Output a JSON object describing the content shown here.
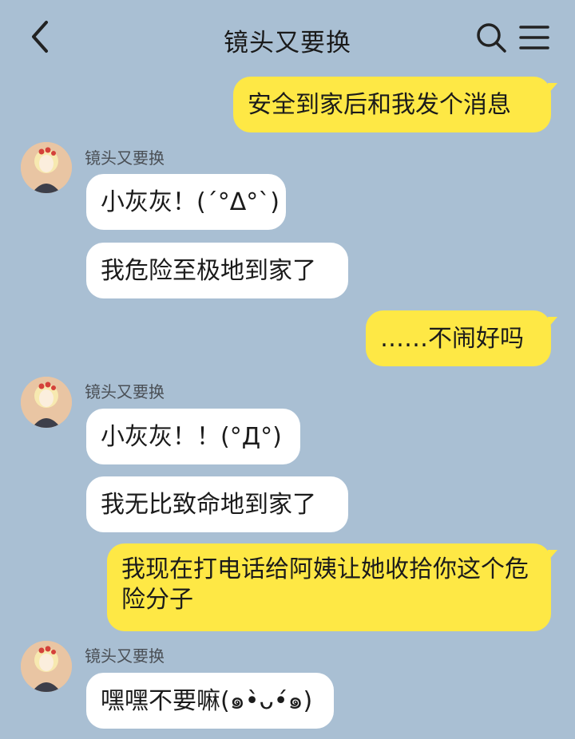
{
  "header": {
    "title": "镜头又要换",
    "back_icon": "chevron-left-icon",
    "search_icon": "search-icon",
    "menu_icon": "menu-icon"
  },
  "messages": [
    {
      "side": "out",
      "text": "安全到家后和我发个消息"
    },
    {
      "side": "in",
      "sender": "镜头又要换",
      "text": "小灰灰！(´°Δ°`)"
    },
    {
      "side": "in",
      "text": "我危险至极地到家了"
    },
    {
      "side": "out",
      "text": "……不闹好吗"
    },
    {
      "side": "in",
      "sender": "镜头又要换",
      "text": "小灰灰！！(°Д°)"
    },
    {
      "side": "in",
      "text": "我无比致命地到家了"
    },
    {
      "side": "out",
      "text": "我现在打电话给阿姨让她收拾你这个危险分子"
    },
    {
      "side": "in",
      "sender": "镜头又要换",
      "text": "嘿嘿不要嘛(๑•̀ᴗ•́๑)"
    }
  ],
  "colors": {
    "background": "#a9bfd3",
    "bubble_out": "#fee845",
    "bubble_in": "#ffffff"
  }
}
